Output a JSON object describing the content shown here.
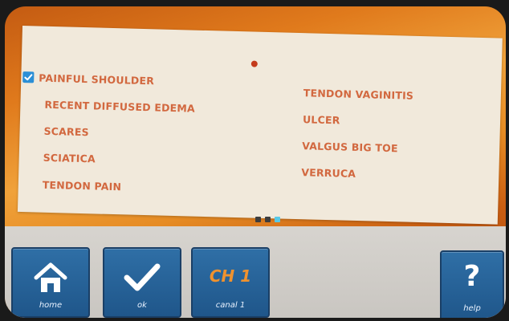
{
  "checklist": {
    "left_column": [
      {
        "label": "PAINFUL SHOULDER",
        "checked": true
      },
      {
        "label": "RECENT DIFFUSED EDEMA",
        "checked": false
      },
      {
        "label": "SCARES",
        "checked": false
      },
      {
        "label": "SCIATICA",
        "checked": false
      },
      {
        "label": "TENDON PAIN",
        "checked": false
      }
    ],
    "right_column": [
      {
        "label": "TENDON VAGINITIS",
        "checked": false
      },
      {
        "label": "ULCER",
        "checked": false
      },
      {
        "label": "VALGUS BIG TOE",
        "checked": false
      },
      {
        "label": "VERRUCA",
        "checked": false
      }
    ]
  },
  "pager": {
    "pages": 3,
    "current_page": 3
  },
  "toolbar": {
    "home_label": "home",
    "ok_label": "ok",
    "channel_title": "CH 1",
    "channel_label": "canal 1",
    "help_symbol": "?",
    "help_label": "help"
  },
  "colors": {
    "item_text": "#d2683f",
    "button_blue": "#1f568a",
    "channel_text": "#f0922e",
    "checkbox": "#2b8fd6",
    "pager_active": "#58c9e6"
  },
  "icons": [
    "home-icon",
    "checkmark-icon",
    "checkbox-checked-icon"
  ]
}
